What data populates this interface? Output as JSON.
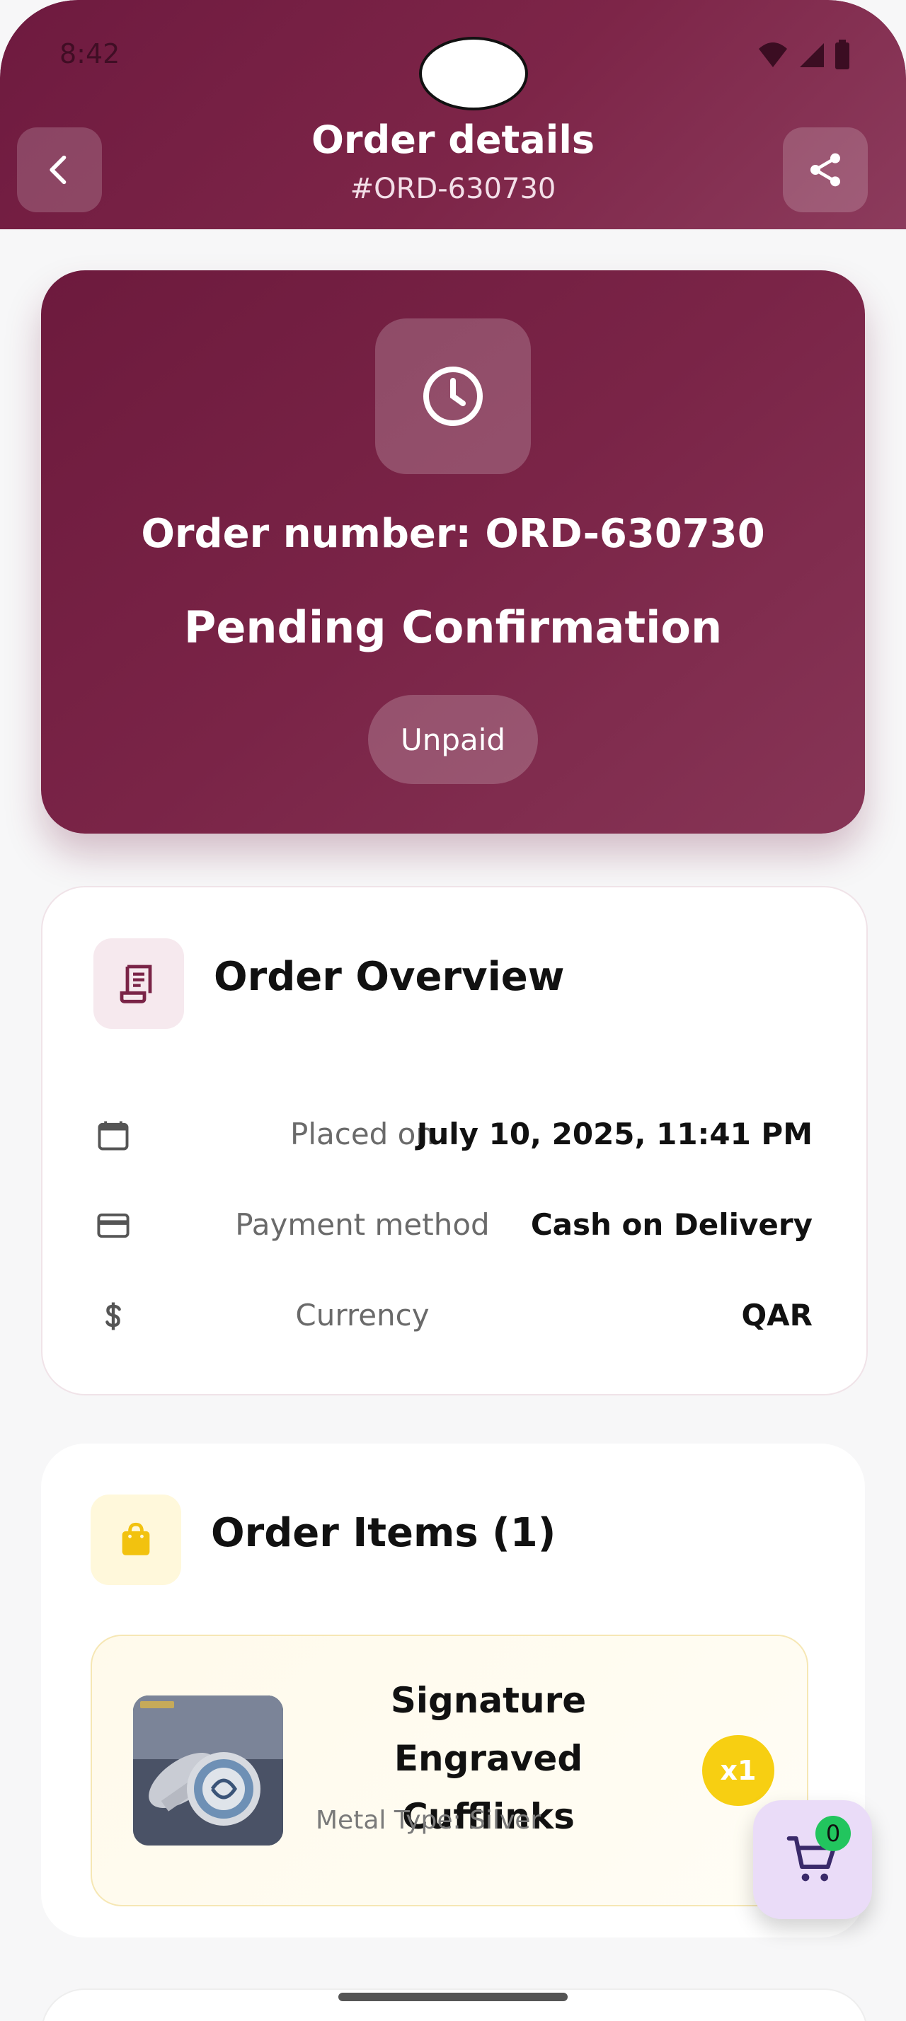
{
  "status_bar": {
    "time": "8:42"
  },
  "header": {
    "title": "Order details",
    "subtitle": "#ORD-630730",
    "back_icon": "chevron-left-icon",
    "share_icon": "share-icon"
  },
  "status_card": {
    "icon": "clock-icon",
    "order_number": "Order number: ORD-630730",
    "status": "Pending Confirmation",
    "payment_status": "Unpaid"
  },
  "overview": {
    "title": "Order Overview",
    "icon": "receipt-icon",
    "rows": [
      {
        "icon": "calendar-icon",
        "label": "Placed on",
        "value": "July 10, 2025, 11:41 PM"
      },
      {
        "icon": "credit-card-icon",
        "label": "Payment method",
        "value": "Cash on Delivery"
      },
      {
        "icon": "dollar-icon",
        "label": "Currency",
        "value": "QAR"
      }
    ]
  },
  "items": {
    "title": "Order Items (1)",
    "icon": "shopping-bag-icon",
    "list": [
      {
        "name": "Signature Engraved Cufflinks",
        "meta": "Metal Type: Silver",
        "quantity": "x1"
      }
    ]
  },
  "cart_fab": {
    "icon": "cart-icon",
    "count": "0"
  },
  "colors": {
    "brand": "#7a2447",
    "accent_yellow": "#f7cf12",
    "badge_green": "#22c55e",
    "fab_bg": "#eadcf8"
  }
}
